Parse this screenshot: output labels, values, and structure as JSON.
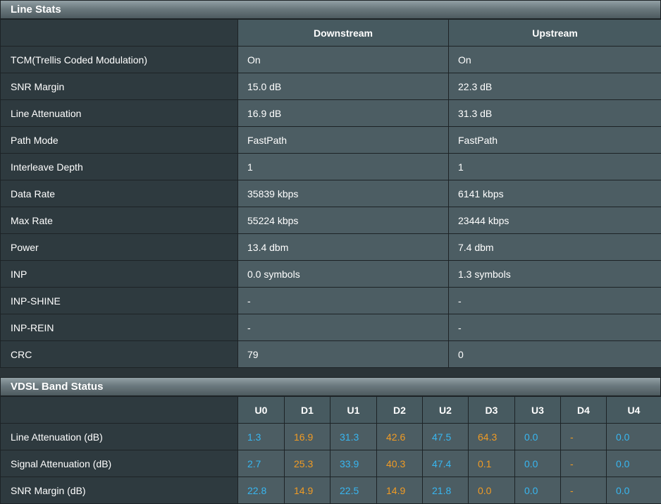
{
  "line_stats": {
    "title": "Line Stats",
    "columns": [
      "Downstream",
      "Upstream"
    ],
    "rows": [
      {
        "label": "TCM(Trellis Coded Modulation)",
        "down": "On",
        "up": "On"
      },
      {
        "label": "SNR Margin",
        "down": "15.0 dB",
        "up": "22.3 dB"
      },
      {
        "label": "Line Attenuation",
        "down": "16.9 dB",
        "up": "31.3 dB"
      },
      {
        "label": "Path Mode",
        "down": "FastPath",
        "up": "FastPath"
      },
      {
        "label": "Interleave Depth",
        "down": "1",
        "up": "1"
      },
      {
        "label": "Data Rate",
        "down": "35839 kbps",
        "up": "6141 kbps"
      },
      {
        "label": "Max Rate",
        "down": "55224 kbps",
        "up": "23444 kbps"
      },
      {
        "label": "Power",
        "down": "13.4 dbm",
        "up": "7.4 dbm"
      },
      {
        "label": "INP",
        "down": "0.0 symbols",
        "up": "1.3 symbols"
      },
      {
        "label": "INP-SHINE",
        "down": "-",
        "up": "-"
      },
      {
        "label": "INP-REIN",
        "down": "-",
        "up": "-"
      },
      {
        "label": "CRC",
        "down": "79",
        "up": "0"
      }
    ]
  },
  "band_status": {
    "title": "VDSL Band Status",
    "bands": [
      "U0",
      "D1",
      "U1",
      "D2",
      "U2",
      "D3",
      "U3",
      "D4",
      "U4"
    ],
    "colors": {
      "upstream": "#38b6f0",
      "downstream": "#f09b24"
    },
    "rows": [
      {
        "label": "Line Attenuation (dB)",
        "values": [
          "1.3",
          "16.9",
          "31.3",
          "42.6",
          "47.5",
          "64.3",
          "0.0",
          "-",
          "0.0"
        ]
      },
      {
        "label": "Signal Attenuation (dB)",
        "values": [
          "2.7",
          "25.3",
          "33.9",
          "40.3",
          "47.4",
          "0.1",
          "0.0",
          "-",
          "0.0"
        ]
      },
      {
        "label": "SNR Margin (dB)",
        "values": [
          "22.8",
          "14.9",
          "22.5",
          "14.9",
          "21.8",
          "0.0",
          "0.0",
          "-",
          "0.0"
        ]
      }
    ]
  }
}
